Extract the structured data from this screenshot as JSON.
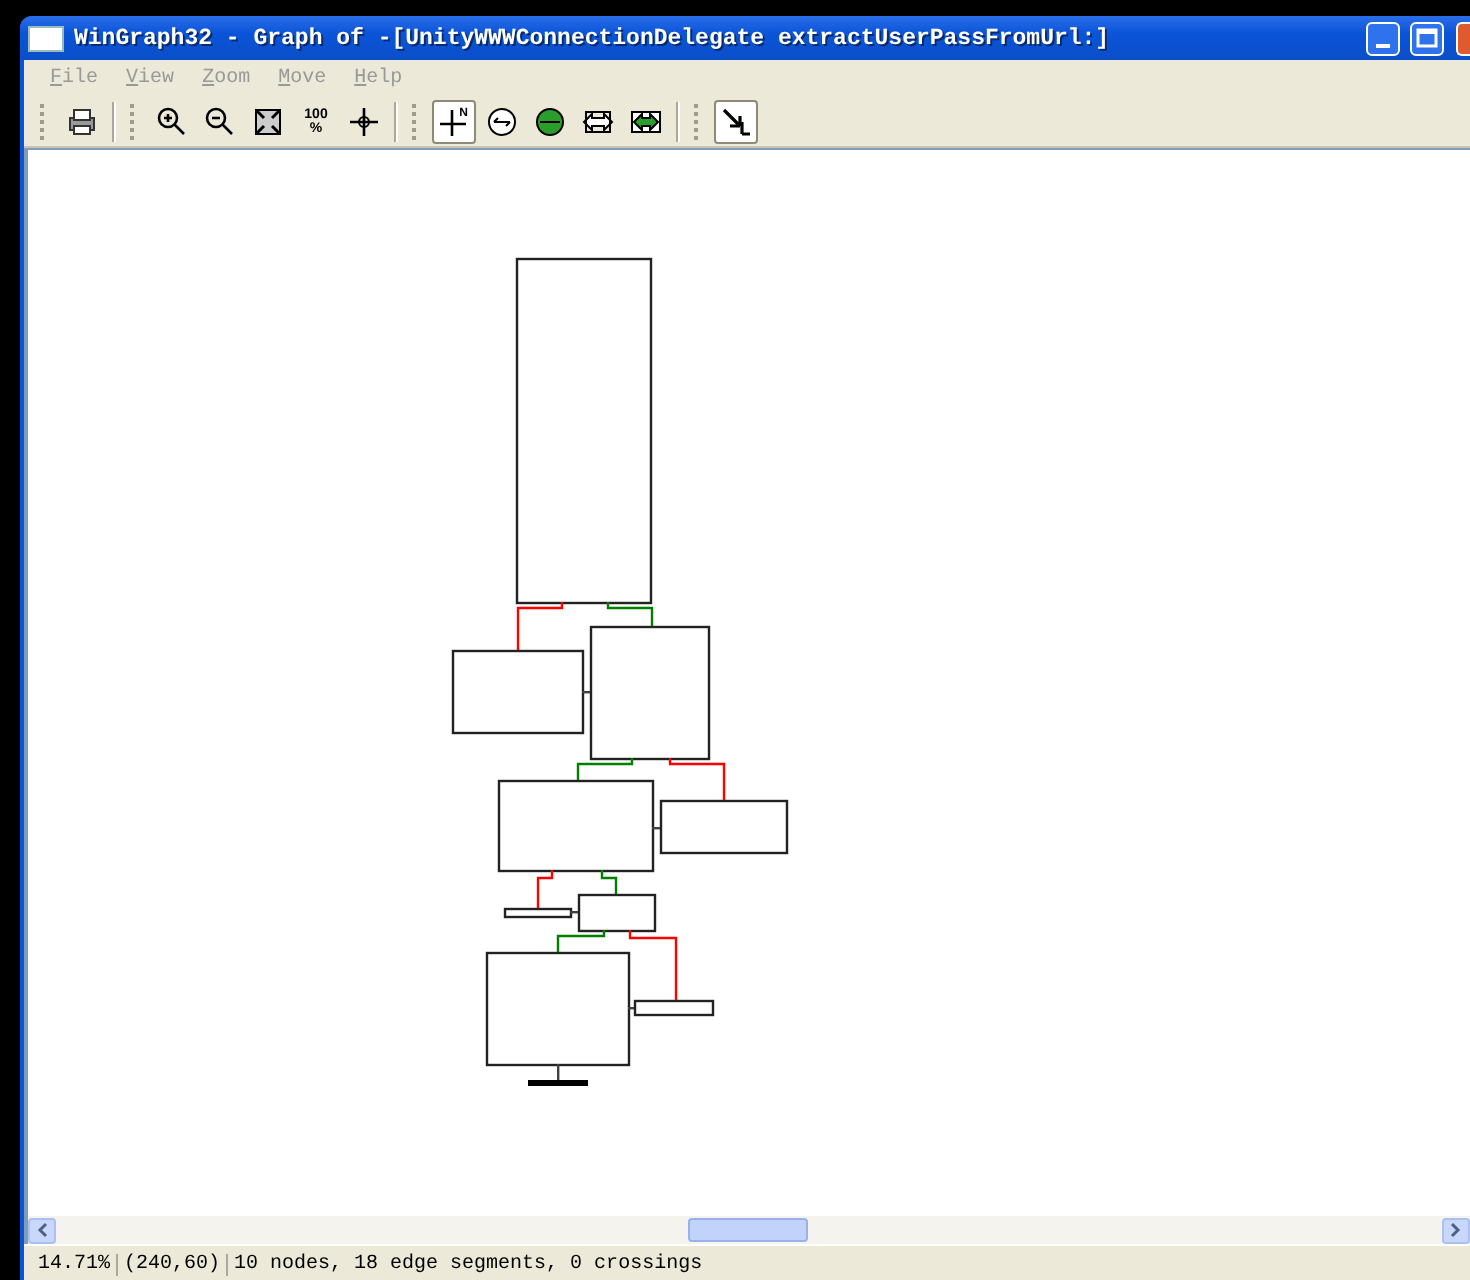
{
  "window": {
    "title": "WinGraph32 - Graph of -[UnityWWWConnectionDelegate extractUserPassFromUrl:]"
  },
  "menu": [
    {
      "label": "File",
      "disabled": true
    },
    {
      "label": "View",
      "disabled": true
    },
    {
      "label": "Zoom",
      "disabled": true
    },
    {
      "label": "Move",
      "disabled": true
    },
    {
      "label": "Help",
      "disabled": true
    }
  ],
  "toolbar": [
    {
      "kind": "print",
      "pressed": false
    },
    {
      "kind": "separator"
    },
    {
      "kind": "zoom-in",
      "pressed": false
    },
    {
      "kind": "zoom-out",
      "pressed": false
    },
    {
      "kind": "fit",
      "pressed": false
    },
    {
      "kind": "scale",
      "pressed": false,
      "label": "100",
      "sub": "%"
    },
    {
      "kind": "center",
      "pressed": false
    },
    {
      "kind": "separator"
    },
    {
      "kind": "axes",
      "pressed": true,
      "label": "N"
    },
    {
      "kind": "circle",
      "pressed": false
    },
    {
      "kind": "green-circle",
      "pressed": false
    },
    {
      "kind": "arrows",
      "pressed": false
    },
    {
      "kind": "green-arrows",
      "pressed": false
    },
    {
      "kind": "separator"
    },
    {
      "kind": "pointer",
      "pressed": true
    }
  ],
  "graph": {
    "edges": [
      {
        "color": "#ff0000"
      },
      {
        "color": "#008000"
      },
      {
        "color": "#008000"
      },
      {
        "color": "#ff0000"
      },
      {
        "color": "#ff0000"
      },
      {
        "color": "#008000"
      },
      {
        "color": "#008000"
      },
      {
        "color": "#ff0000"
      }
    ]
  },
  "status_bar": [
    "14.71%",
    "(240,60)",
    "10 nodes, 18 edge segments, 0 crossings"
  ]
}
